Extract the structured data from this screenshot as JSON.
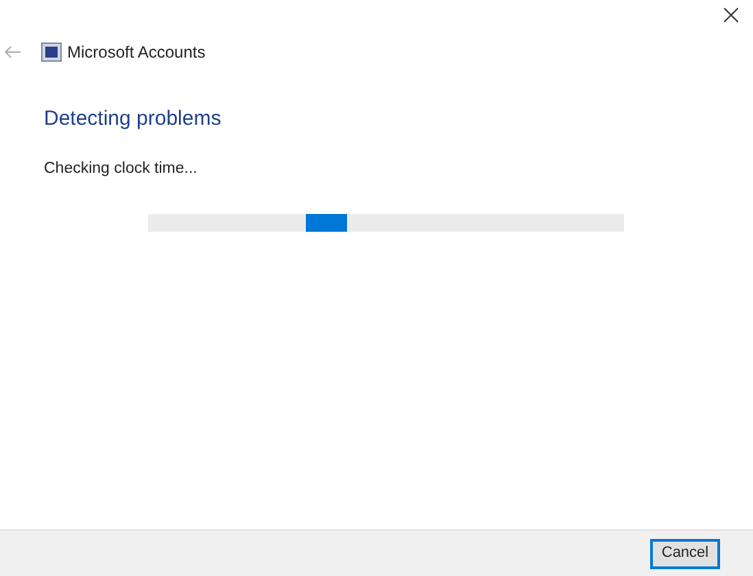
{
  "window": {
    "title": "Microsoft Accounts"
  },
  "heading": "Detecting problems",
  "status": "Checking clock time...",
  "progress": {
    "kind": "indeterminate",
    "level": 0.33
  },
  "buttons": [
    "Cancel"
  ]
}
